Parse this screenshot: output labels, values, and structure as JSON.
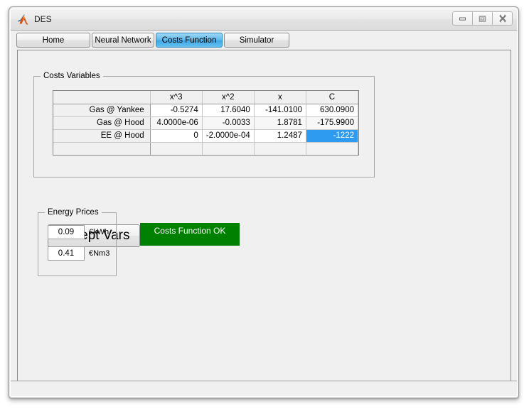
{
  "window": {
    "title": "DES",
    "app_icon": "matlab-membrane-icon",
    "controls": {
      "minimize": "minimize-icon",
      "maximize": "maximize-icon",
      "close": "close-icon"
    }
  },
  "tabs": [
    {
      "label": "Home",
      "active": false
    },
    {
      "label": "Neural Network",
      "active": false
    },
    {
      "label": "Costs Function",
      "active": true
    },
    {
      "label": "Simulator",
      "active": false
    }
  ],
  "costs_panel": {
    "title": "Costs Variables",
    "table": {
      "columns": [
        "",
        "x^3",
        "x^2",
        "x",
        "C"
      ],
      "rows": [
        {
          "label": "Gas @ Yankee",
          "values": [
            "-0.5274",
            "17.6040",
            "-141.0100",
            "630.0900"
          ]
        },
        {
          "label": "Gas @ Hood",
          "values": [
            "4.0000e-06",
            "-0.0033",
            "1.8781",
            "-175.9900"
          ]
        },
        {
          "label": "EE @ Hood",
          "values": [
            "0",
            "-2.0000e-04",
            "1.2487",
            "-1222"
          ]
        },
        {
          "label": "",
          "values": [
            "",
            "",
            "",
            ""
          ]
        }
      ],
      "selected_cell": {
        "row": 2,
        "column": 3,
        "value": "-1222"
      }
    }
  },
  "actions": {
    "accept_vars_label": "Accept Vars",
    "status_label": "Costs Function OK",
    "status_color": "#008000",
    "status_text_color": "#ffffff"
  },
  "energy_prices": {
    "title": "Energy Prices",
    "fields": [
      {
        "value": "0.09",
        "unit": "€kWh"
      },
      {
        "value": "0.41",
        "unit": "€Nm3"
      }
    ]
  },
  "colors": {
    "selection_blue": "#2e9bf0",
    "active_tab_blue": "#3fa9e4",
    "window_bg": "#f0f0f0"
  }
}
